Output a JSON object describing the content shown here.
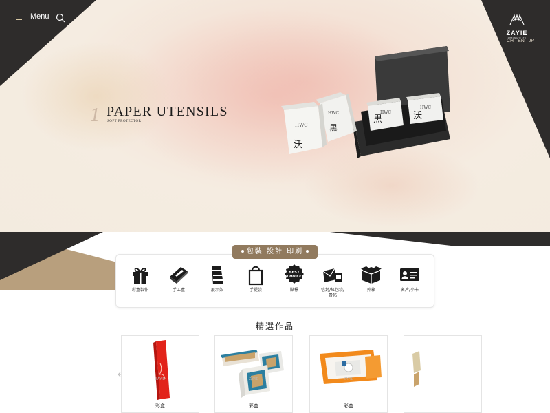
{
  "header": {
    "menu_label": "Menu",
    "logo_name": "ZAYIE",
    "logo_sub": "ZHEANG YI LTD",
    "languages": [
      "CH",
      "EN",
      "JP"
    ]
  },
  "hero": {
    "slide_number": "1",
    "title": "PAPER UTENSILS",
    "subtitle": "SOFT PROTECTOR",
    "box_brand": "HWC",
    "char_1": "沃",
    "char_2": "黒"
  },
  "categories": {
    "heading": "包裝 設計 印刷",
    "items": [
      {
        "label": "彩盒製作",
        "icon": "gift-box-icon"
      },
      {
        "label": "手工盒",
        "icon": "handmade-box-icon"
      },
      {
        "label": "展示架",
        "icon": "display-rack-icon"
      },
      {
        "label": "手提袋",
        "icon": "shopping-bag-icon"
      },
      {
        "label": "貼標",
        "icon": "best-choice-label-icon"
      },
      {
        "label": "信封/紅包袋/\n貴帖",
        "icon": "envelope-icon"
      },
      {
        "label": "外箱",
        "icon": "carton-box-icon"
      },
      {
        "label": "名片/小卡",
        "icon": "business-card-icon"
      }
    ]
  },
  "featured": {
    "title": "精選作品",
    "watermark": "ZAYIE",
    "cards": [
      {
        "caption": "彩盒"
      },
      {
        "caption": "彩盒"
      },
      {
        "caption": "彩盒"
      },
      {
        "caption": ""
      }
    ]
  },
  "colors": {
    "dark": "#2e2c2b",
    "brown": "#b89f7d",
    "pill": "#917a5e"
  }
}
